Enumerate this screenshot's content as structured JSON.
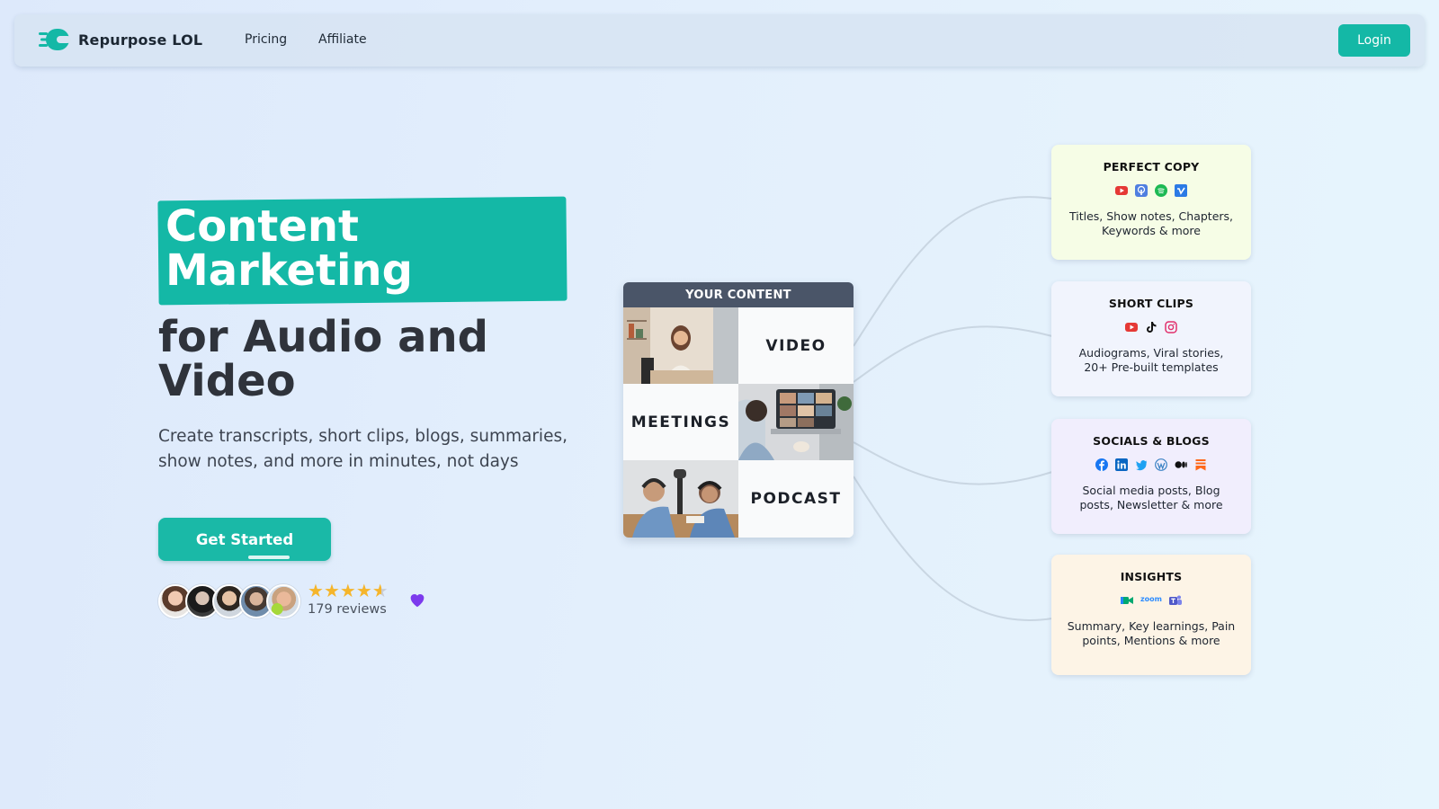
{
  "nav": {
    "brand": "Repurpose LOL",
    "links": [
      "Pricing",
      "Affiliate"
    ],
    "login": "Login"
  },
  "hero": {
    "highlight": "Content Marketing",
    "headline_rest": "for Audio and Video",
    "subtext": "Create transcripts, short clips, blogs, summaries, show notes, and more in minutes, not days",
    "cta": "Get Started",
    "rating": 4.5,
    "reviews": "179 reviews"
  },
  "content_card": {
    "header": "YOUR CONTENT",
    "labels": [
      "VIDEO",
      "MEETINGS",
      "PODCAST"
    ]
  },
  "outputs": [
    {
      "title": "PERFECT COPY",
      "icons": [
        "youtube-icon",
        "apple-podcasts-icon",
        "spotify-icon",
        "vimeo-icon"
      ],
      "desc": "Titles, Show notes, Chapters, Keywords & more"
    },
    {
      "title": "SHORT CLIPS",
      "icons": [
        "youtube-icon",
        "tiktok-icon",
        "instagram-icon"
      ],
      "desc": "Audiograms, Viral stories, 20+ Pre-built templates"
    },
    {
      "title": "SOCIALS & BLOGS",
      "icons": [
        "facebook-icon",
        "linkedin-icon",
        "twitter-icon",
        "wordpress-icon",
        "medium-icon",
        "substack-icon"
      ],
      "desc": "Social media posts, Blog posts, Newsletter & more"
    },
    {
      "title": "INSIGHTS",
      "icons": [
        "google-meet-icon",
        "zoom-icon",
        "teams-icon"
      ],
      "zoom_text": "zoom",
      "desc": "Summary, Key learnings, Pain points, Mentions & more"
    }
  ],
  "colors": {
    "accent": "#14b8a6",
    "star": "#f5b52b",
    "heart": "#7c3aed",
    "content_header": "#4a5568"
  }
}
